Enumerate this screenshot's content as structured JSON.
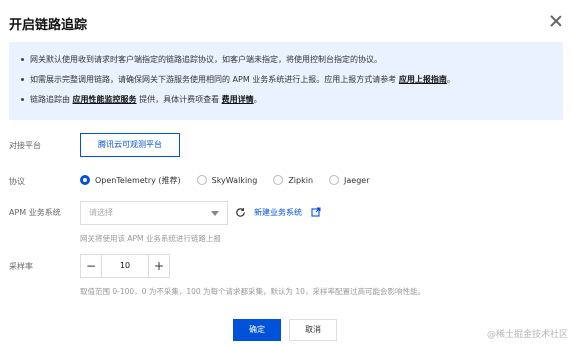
{
  "dialog": {
    "title": "开启链路追踪",
    "close_icon": "close-icon"
  },
  "notice": {
    "line1": "网关默认使用收到请求时客户端指定的链路追踪协议，如客户端未指定，将使用控制台指定的协议。",
    "line2_pre": "如需展示完整调用链路，请确保网关下游服务使用相同的 APM 业务系统进行上报。应用上报方式请参考",
    "line2_link": "应用上报指南",
    "line2_post": "。",
    "line3_pre": "链路追踪由",
    "line3_link1": "应用性能监控服务",
    "line3_mid": "提供，具体计费项查看",
    "line3_link2": "费用详情",
    "line3_post": "。"
  },
  "form": {
    "platform_label": "对接平台",
    "platform_value": "腾讯云可观测平台",
    "protocol_label": "协议",
    "protocols": [
      {
        "label": "OpenTelemetry (推荐)",
        "checked": true
      },
      {
        "label": "SkyWalking",
        "checked": false
      },
      {
        "label": "Zipkin",
        "checked": false
      },
      {
        "label": "Jaeger",
        "checked": false
      }
    ],
    "apm_label": "APM 业务系统",
    "apm_placeholder": "请选择",
    "new_system_link": "新建业务系统",
    "apm_hint": "网关将使用该 APM 业务系统进行链路上报",
    "sample_label": "采样率",
    "sample_value": "10",
    "sample_hint": "取值范围 0-100，0 为不采集，100 为每个请求都采集，默认为 10，采样率配置过高可能会影响性能。"
  },
  "footer": {
    "ok_label": "确定",
    "cancel_label": "取消"
  },
  "watermark": "@稀土掘金技术社区",
  "colors": {
    "accent": "#0052d9",
    "notice_bg": "#eaf2ff"
  }
}
